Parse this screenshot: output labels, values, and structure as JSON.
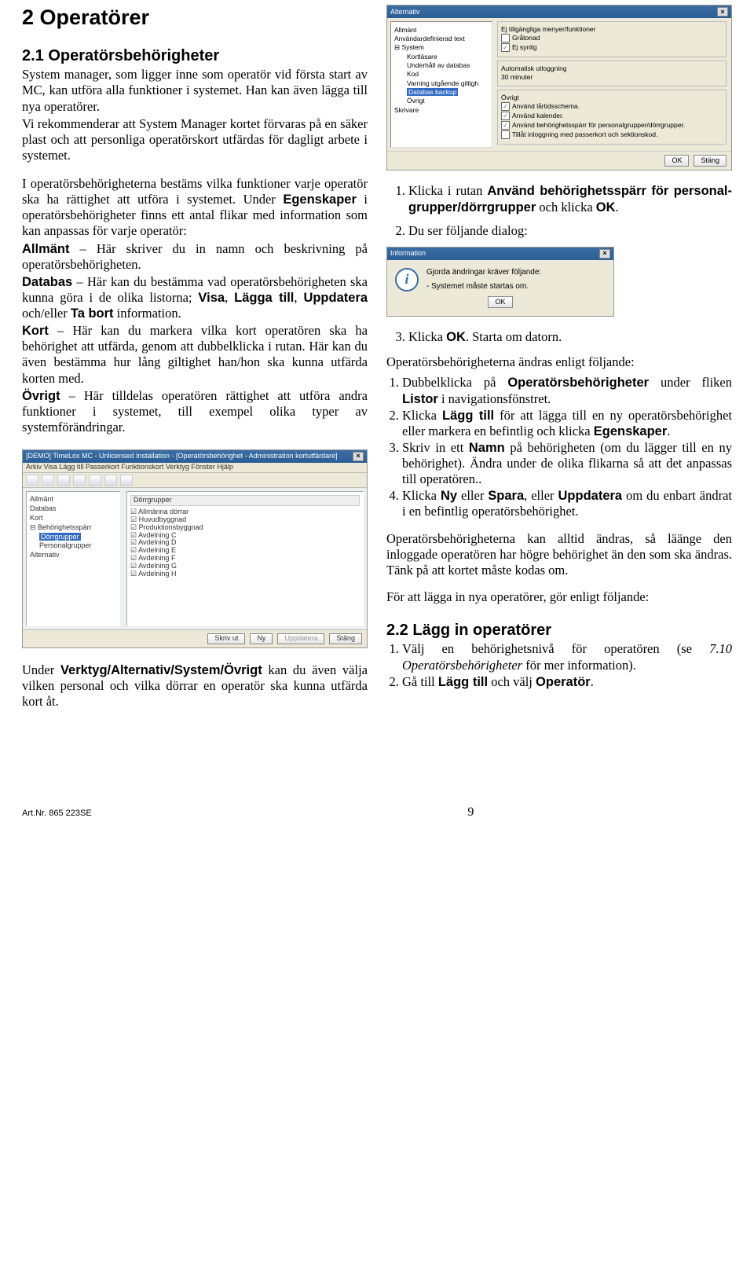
{
  "heading1": "2 Operatörer",
  "heading1_1": "2.1 Operatörsbehörigheter",
  "left": {
    "p1a": "System manager, som ligger inne som operatör vid första start av MC, kan utföra alla funktioner i systemet. Han kan även lägga till nya operatörer.",
    "p1b": "Vi rekommenderar att System Manager kortet förvaras på en säker plast och att personliga operatörskort utfärdas för dagligt arbete i systemet.",
    "p2a": "I operatörsbehörigheterna bestäms vilka funktioner varje operatör ska ha rättighet att utföra i systemet. Under ",
    "p2b_bold": "Egenskaper",
    "p2c": " i operatörsbehörigheter finns ett antal flikar med information som kan anpassas för varje operatör:",
    "allm_b": "Allmänt",
    "allm": " – Här skriver du in namn och beskrivning på operatörsbehörigheten.",
    "db_b": "Databas",
    "db": " – Här kan du bestämma vad operatörsbehörigheten ska kunna göra i de olika listorna; ",
    "db_visa": "Visa",
    "db_lagg": "Lägga till",
    "db_upd": "Uppdatera",
    "db_mid": ", ",
    "db_andor": " och/eller ",
    "db_tab": "Ta bort",
    "db_end": " information.",
    "kort_b": "Kort",
    "kort": " – Här kan du markera vilka kort operatören ska ha behörighet att utfärda, genom att dubbelklicka i rutan. Här kan du även bestämma hur lång giltighet han/hon ska kunna utfärda korten med.",
    "ovr_b": "Övrigt",
    "ovr": " – Här tilldelas operatören rättighet att utföra andra funktioner i systemet, till exempel olika typer av systemförändringar.",
    "p3a": "Under ",
    "p3a_b": "Verktyg/Alternativ/System/Övrigt",
    "p3b": " kan du även välja vilken personal och vilka dörrar en operatör ska kunna utfärda kort åt."
  },
  "right": {
    "li1a": "Klicka i rutan ",
    "li1b": "Använd behörighetsspärr för personal­grupper/dörrgrupper",
    "li1c": " och klicka ",
    "li1d": "OK",
    "li1e": ".",
    "li2": "Du ser följande dialog:",
    "li3a": "Klicka ",
    "li3b": "OK",
    "li3c": ". Starta om datorn.",
    "p4": "Operatörsbehörigheterna ändras enligt följande:",
    "ol2_1a": "Dubbelklicka på ",
    "ol2_1b": "Operatörs­behörigheter",
    "ol2_1c": " under fliken ",
    "ol2_1d": "Listor",
    "ol2_1e": " i navigationsfönstret.",
    "ol2_2a": "Klicka ",
    "ol2_2b": "Lägg till",
    "ol2_2c": " för att lägga till en ny operatörsbehörighet eller markera en befintlig och klicka ",
    "ol2_2d": "Egenskaper",
    "ol2_2e": ".",
    "ol2_3a": "Skriv in ett ",
    "ol2_3b": "Namn",
    "ol2_3c": " på behörigheten (om du lägger till en ny behörighet). Ändra under de olika flikarna så att det anpassas till operatören..",
    "ol2_4a": "Klicka ",
    "ol2_4b": "Ny",
    "ol2_4c": " eller ",
    "ol2_4d": "Spara",
    "ol2_4e": ", eller ",
    "ol2_4f": "Uppdatera",
    "ol2_4g": " om du enbart ändrat i en befintlig operatörsbehörighet.",
    "p5": "Operatörsbehörigheterna kan alltid ändras, så läänge den inloggade operatören har högre behörighet än den som ska ändras. Tänk på att kortet måste kodas om.",
    "p6": "För att lägga in nya operatörer, gör enligt följande:",
    "h22": "2.2 Lägg in operatörer",
    "ol3_1a": "Välj en behörighetsnivå för operatören (se ",
    "ol3_1b": "7.10 Operatörsbehörigheter",
    "ol3_1c": " för mer information).",
    "ol3_2a": "Gå till ",
    "ol3_2b": "Lägg till",
    "ol3_2c": " och välj ",
    "ol3_2d": "Operatör",
    "ol3_2e": "."
  },
  "screenshot1": {
    "title": "[DEMO]  TimeLox MC - Unlicensed Installation - [Operatörsbehörighet - Administration kortutfärdare]",
    "menu": "Arkiv  Visa  Lägg till  Passerkort  Funktionskort  Verktyg  Fönster  Hjälp",
    "tree": [
      "Allmänt",
      "Databas",
      "Kort",
      "Behörighetsspärr",
      "Dörrgrupper",
      "Personalgrupper",
      "Alternativ"
    ],
    "tree_sel": 4,
    "list_hdr": "Dörrgrupper",
    "list": [
      "Allmänna dörrar",
      "Huvudbyggnad",
      "Produktionsbyggnad",
      "Avdelning C",
      "Avdelning D",
      "Avdelning E",
      "Avdelning F",
      "Avdelning G",
      "Avdelning H"
    ],
    "btns": [
      "Skriv ut",
      "Ny",
      "Uppdatera",
      "Stäng"
    ]
  },
  "altshot": {
    "title": "Alternativ",
    "tree": [
      "Allmänt",
      "Användardefinierad text",
      "System",
      "Kortläsare",
      "Underhåll av databas",
      "Kod",
      "Varning utgående giltigh",
      "Databas backup",
      "Övrigt",
      "Skrivare"
    ],
    "tree_sel": 7,
    "g1_lbl": "Ej tillgängliga menyer/funktioner",
    "g1_items": [
      "Gråtonad",
      "Ej synlig"
    ],
    "g2_lbl": "Automatisk utloggning",
    "g2_row": "30   minuter",
    "g3_lbl": "Övrigt",
    "g3_items": [
      "Använd lårtidsschema.",
      "Använd kalender.",
      "Använd behörighetsspärr för personalgrupper/dörrgrupper.",
      "Tillåt inloggning med passerkort och sektionskod."
    ],
    "btns": [
      "OK",
      "Stäng"
    ]
  },
  "infoshot": {
    "title": "Information",
    "line1": "Gjorda ändringar kräver följande:",
    "line2": "- Systemet måste startas om.",
    "btn": "OK"
  },
  "footer": {
    "artnr": "Art.Nr. 865 223SE",
    "page": "9"
  }
}
